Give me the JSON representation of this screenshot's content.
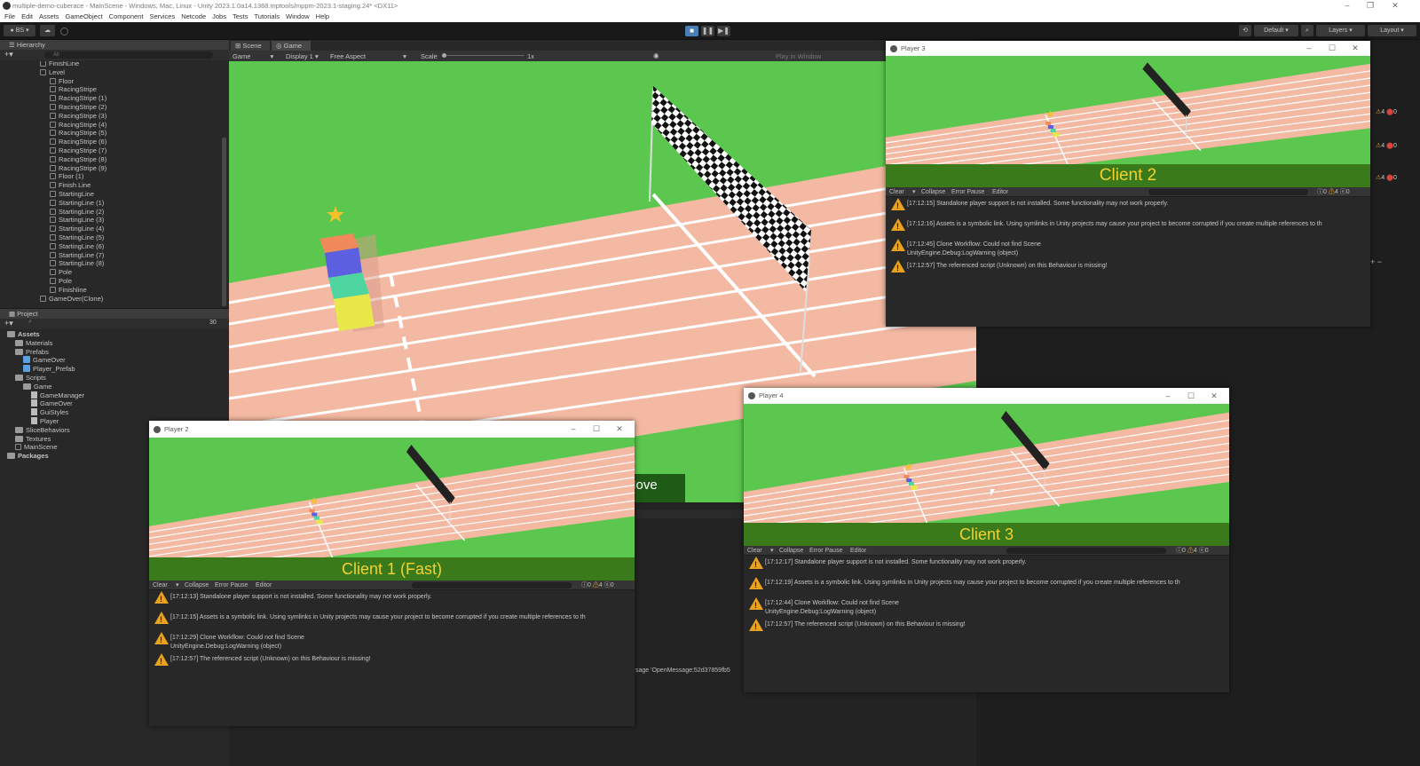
{
  "titlebar": {
    "title": "multiple-demo-cuberace - MainScene - Windows, Mac, Linux - Unity 2023.1.0a14.1368.mptools/mppm-2023.1-staging.24* <DX11>"
  },
  "menu": [
    "File",
    "Edit",
    "Assets",
    "GameObject",
    "Component",
    "Services",
    "Netcode",
    "Jobs",
    "Tests",
    "Tutorials",
    "Window",
    "Help"
  ],
  "toolbar": {
    "account": "BS",
    "default_label": "Default",
    "layers": "Layers",
    "layout": "Layout"
  },
  "hierarchy": {
    "title": "Hierarchy",
    "search": "All",
    "items": [
      {
        "label": "FinishLine",
        "indent": 3
      },
      {
        "label": "Level",
        "indent": 3
      },
      {
        "label": "Floor",
        "indent": 4
      },
      {
        "label": "RacingStripe",
        "indent": 4
      },
      {
        "label": "RacingStripe (1)",
        "indent": 4
      },
      {
        "label": "RacingStripe (2)",
        "indent": 4
      },
      {
        "label": "RacingStripe (3)",
        "indent": 4
      },
      {
        "label": "RacingStripe (4)",
        "indent": 4
      },
      {
        "label": "RacingStripe (5)",
        "indent": 4
      },
      {
        "label": "RacingStripe (6)",
        "indent": 4
      },
      {
        "label": "RacingStripe (7)",
        "indent": 4
      },
      {
        "label": "RacingStripe (8)",
        "indent": 4
      },
      {
        "label": "RacingStripe (9)",
        "indent": 4
      },
      {
        "label": "Floor (1)",
        "indent": 4
      },
      {
        "label": "Finish Line",
        "indent": 4
      },
      {
        "label": "StartingLine",
        "indent": 4
      },
      {
        "label": "StartingLine (1)",
        "indent": 4
      },
      {
        "label": "StartingLine (2)",
        "indent": 4
      },
      {
        "label": "StartingLine (3)",
        "indent": 4
      },
      {
        "label": "StartingLine (4)",
        "indent": 4
      },
      {
        "label": "StartingLine (5)",
        "indent": 4
      },
      {
        "label": "StartingLine (6)",
        "indent": 4
      },
      {
        "label": "StartingLine (7)",
        "indent": 4
      },
      {
        "label": "StartingLine (8)",
        "indent": 4
      },
      {
        "label": "Pole",
        "indent": 4
      },
      {
        "label": "Pole",
        "indent": 4
      },
      {
        "label": "Finishline",
        "indent": 4
      },
      {
        "label": "GameOver(Clone)",
        "indent": 3
      }
    ]
  },
  "project": {
    "title": "Project",
    "count": "30",
    "items": [
      {
        "label": "Assets",
        "indent": 0,
        "type": "folder",
        "bold": true
      },
      {
        "label": "Materials",
        "indent": 1,
        "type": "folder"
      },
      {
        "label": "Prefabs",
        "indent": 1,
        "type": "folder"
      },
      {
        "label": "GameOver",
        "indent": 2,
        "type": "prefab"
      },
      {
        "label": "Player_Prefab",
        "indent": 2,
        "type": "prefab"
      },
      {
        "label": "Scripts",
        "indent": 1,
        "type": "folder"
      },
      {
        "label": "Game",
        "indent": 2,
        "type": "folder"
      },
      {
        "label": "GameManager",
        "indent": 3,
        "type": "script"
      },
      {
        "label": "GameOver",
        "indent": 3,
        "type": "script"
      },
      {
        "label": "GuiStyles",
        "indent": 3,
        "type": "script"
      },
      {
        "label": "Player",
        "indent": 3,
        "type": "script"
      },
      {
        "label": "SliceBehaviors",
        "indent": 1,
        "type": "folder"
      },
      {
        "label": "Textures",
        "indent": 1,
        "type": "folder"
      },
      {
        "label": "MainScene",
        "indent": 1,
        "type": "scene"
      },
      {
        "label": "Packages",
        "indent": 0,
        "type": "folder",
        "bold": true
      }
    ]
  },
  "scene_tabs": {
    "scene": "Scene",
    "game": "Game"
  },
  "game_bar": {
    "mode": "Game",
    "display": "Display 1",
    "aspect": "Free Aspect",
    "scale_label": "Scale",
    "scale_value": "1x",
    "play_in": "Play in Window"
  },
  "main_game": {
    "move_text": "Move",
    "bottom_text": "sage 'OpenMessage:52d37859fb5"
  },
  "console_bar": {
    "clear": "Clear",
    "collapse": "Collapse",
    "error_pause": "Error Pause",
    "editor": "Editor"
  },
  "windows": {
    "player2": {
      "title": "Player 2",
      "client_label": "Client 1 (Fast)",
      "counts": {
        "info": "0",
        "warn": "4",
        "error": "0"
      },
      "logs": [
        "[17:12:13] Standalone player support is not installed. Some functionality may not work properly.",
        "[17:12:15] Assets is a symbolic link. Using symlinks in Unity projects may cause your project to become corrupted if you create multiple references to th",
        "[17:12:29] Clone Workflow: Could not find Scene",
        "UnityEngine.Debug:LogWarning (object)",
        "[17:12:57] The referenced script (Unknown) on this Behaviour is missing!"
      ]
    },
    "player3": {
      "title": "Player 3",
      "client_label": "Client 2",
      "counts": {
        "info": "0",
        "warn": "4",
        "error": "0"
      },
      "logs": [
        "[17:12:15] Standalone player support is not installed. Some functionality may not work properly.",
        "[17:12:16] Assets is a symbolic link. Using symlinks in Unity projects may cause your project to become corrupted if you create multiple references to th",
        "[17:12:45] Clone Workflow: Could not find Scene",
        "UnityEngine.Debug:LogWarning (object)",
        "[17:12:57] The referenced script (Unknown) on this Behaviour is missing!"
      ]
    },
    "player4": {
      "title": "Player 4",
      "client_label": "Client 3",
      "counts": {
        "info": "0",
        "warn": "4",
        "error": "0"
      },
      "logs": [
        "[17:12:17] Standalone player support is not installed. Some functionality may not work properly.",
        "[17:12:19] Assets is a symbolic link. Using symlinks in Unity projects may cause your project to become corrupted if you create multiple references to th",
        "[17:12:44] Clone Workflow: Could not find Scene",
        "UnityEngine.Debug:LogWarning (object)",
        "[17:12:57] The referenced script (Unknown) on this Behaviour is missing!"
      ]
    }
  },
  "right_panel_counts": [
    {
      "warn": "4",
      "error": "0"
    },
    {
      "warn": "4",
      "error": "0"
    },
    {
      "warn": "4",
      "error": "0"
    }
  ],
  "colors": {
    "grass": "#5cc74f",
    "track": "#f4b9a2",
    "lane": "#ffffff",
    "client_label": "#f3d12e",
    "warning": "#e8a220",
    "cube_colors": [
      "#f08a5a",
      "#5b5fe0",
      "#4fd6a0",
      "#e8e84a"
    ]
  }
}
